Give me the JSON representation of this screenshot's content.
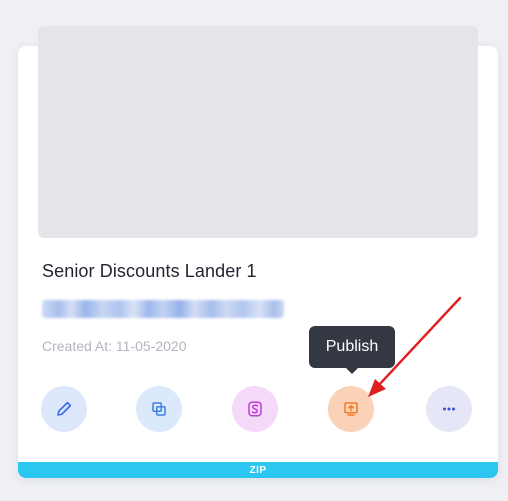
{
  "page": {
    "name": "Senior Discounts Lander 1",
    "created_at": "Created At: 11-05-2020",
    "type_badge": "ZIP"
  },
  "tooltip": {
    "text": "Publish"
  },
  "actions": [
    {
      "id": "edit",
      "icon": "pencil-icon",
      "color": "#3b6ee6"
    },
    {
      "id": "clone",
      "icon": "clone-icon",
      "color": "#3b82e6"
    },
    {
      "id": "split",
      "icon": "split-test-icon",
      "color": "#c03ad8"
    },
    {
      "id": "publish",
      "icon": "publish-icon",
      "color": "#f07a2c"
    },
    {
      "id": "more",
      "icon": "ellipsis-icon",
      "color": "#3b4fd8"
    }
  ],
  "colors": {
    "annotation_arrow": "#e02020",
    "badge": "#2cc7f0"
  }
}
